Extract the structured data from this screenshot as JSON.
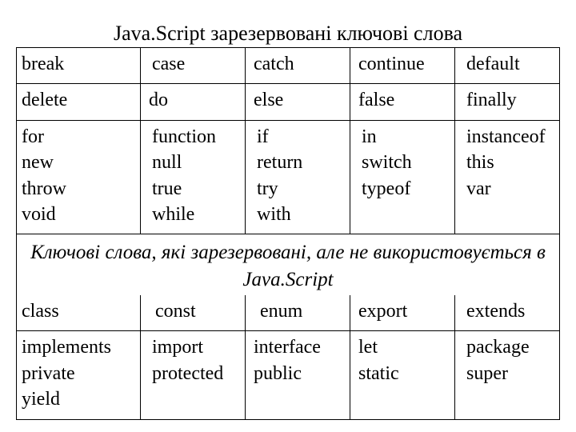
{
  "title1": "Java.Script зарезервовані ключові слова",
  "section1": {
    "rows": [
      [
        "break",
        "case",
        "catch",
        "continue",
        "default"
      ],
      [
        "delete",
        "do",
        "else",
        "false",
        "finally"
      ],
      [
        "for\nnew\nthrow\nvoid",
        "function\nnull\ntrue\nwhile",
        "if\nreturn\ntry\nwith",
        "in\nswitch\ntypeof",
        "instanceof\nthis\nvar"
      ]
    ]
  },
  "title2_line1": "Ключові слова, які зарезервовані, але не використовується в",
  "title2_line2": "Java.Script",
  "section2": {
    "rows": [
      [
        "class",
        "const",
        "enum",
        "export",
        "extends"
      ],
      [
        "implements\nprivate\nyield",
        "import\nprotected",
        "interface\npublic",
        "let\nstatic",
        "package\nsuper"
      ]
    ]
  },
  "chart_data": {
    "type": "table",
    "title": "JavaScript reserved keywords (Ukrainian reference table)",
    "tables": [
      {
        "caption": "Java.Script зарезервовані ключові слова",
        "rows": [
          [
            "break",
            "case",
            "catch",
            "continue",
            "default"
          ],
          [
            "delete",
            "do",
            "else",
            "false",
            "finally"
          ],
          [
            "for",
            "function",
            "if",
            "in",
            "instanceof"
          ],
          [
            "new",
            "null",
            "return",
            "switch",
            "this"
          ],
          [
            "throw",
            "true",
            "try",
            "typeof",
            "var"
          ],
          [
            "void",
            "while",
            "with",
            "",
            ""
          ]
        ]
      },
      {
        "caption": "Ключові слова, які зарезервовані, але не використовується в Java.Script",
        "rows": [
          [
            "class",
            "const",
            "enum",
            "export",
            "extends"
          ],
          [
            "implements",
            "import",
            "interface",
            "let",
            "package"
          ],
          [
            "private",
            "protected",
            "public",
            "static",
            "super"
          ],
          [
            "yield",
            "",
            "",
            "",
            ""
          ]
        ]
      }
    ]
  }
}
